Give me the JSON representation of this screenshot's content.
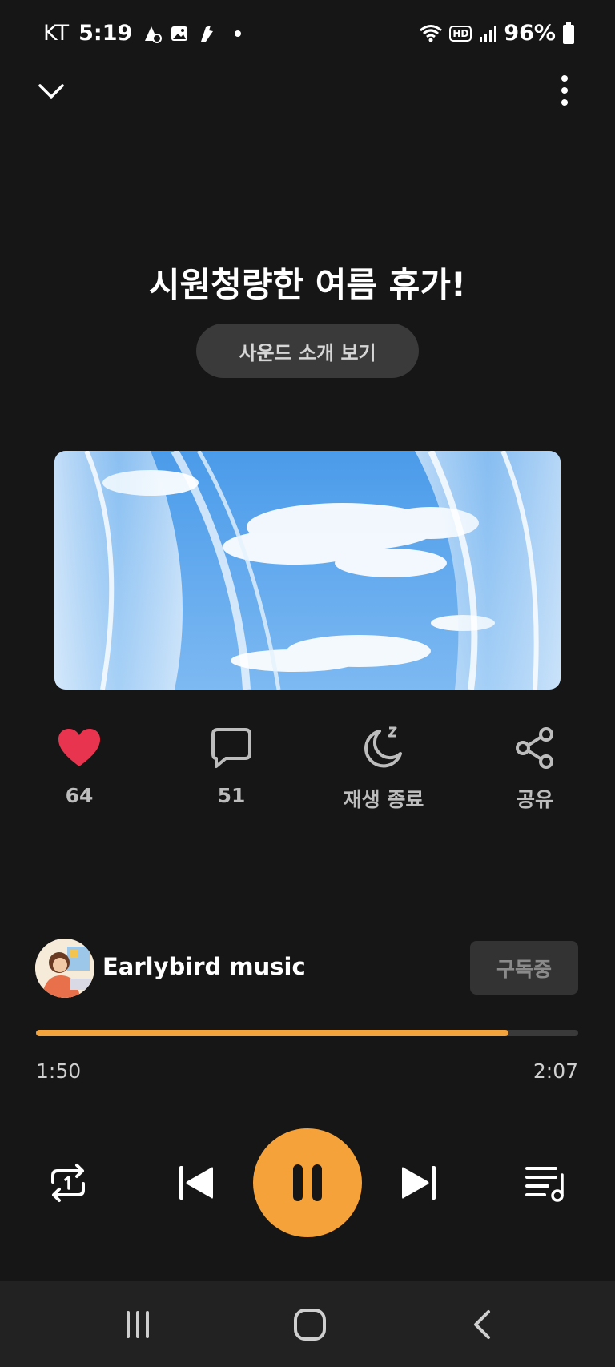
{
  "status_bar": {
    "carrier": "KT",
    "time": "5:19",
    "hd": "HD",
    "battery": "96%"
  },
  "player": {
    "title": "시원청량한 여름 휴가!",
    "intro_button": "사운드 소개 보기",
    "likes": "64",
    "comments": "51",
    "sleep_label": "재생 종료",
    "share_label": "공유",
    "channel_name": "Earlybird music",
    "subscribe_label": "구독중",
    "elapsed": "1:50",
    "total": "2:07",
    "progress_fraction": 0.872
  },
  "colors": {
    "accent": "#F6A23A",
    "like": "#E8344E",
    "background": "#161616"
  },
  "icons": {
    "collapse": "chevron-down-icon",
    "more": "more-vertical-icon",
    "like": "heart-icon",
    "comment": "comment-icon",
    "sleep": "moon-sleep-icon",
    "share": "share-icon",
    "repeat": "repeat-one-icon",
    "prev": "skip-previous-icon",
    "pause": "pause-icon",
    "next": "skip-next-icon",
    "queue": "playlist-icon"
  }
}
